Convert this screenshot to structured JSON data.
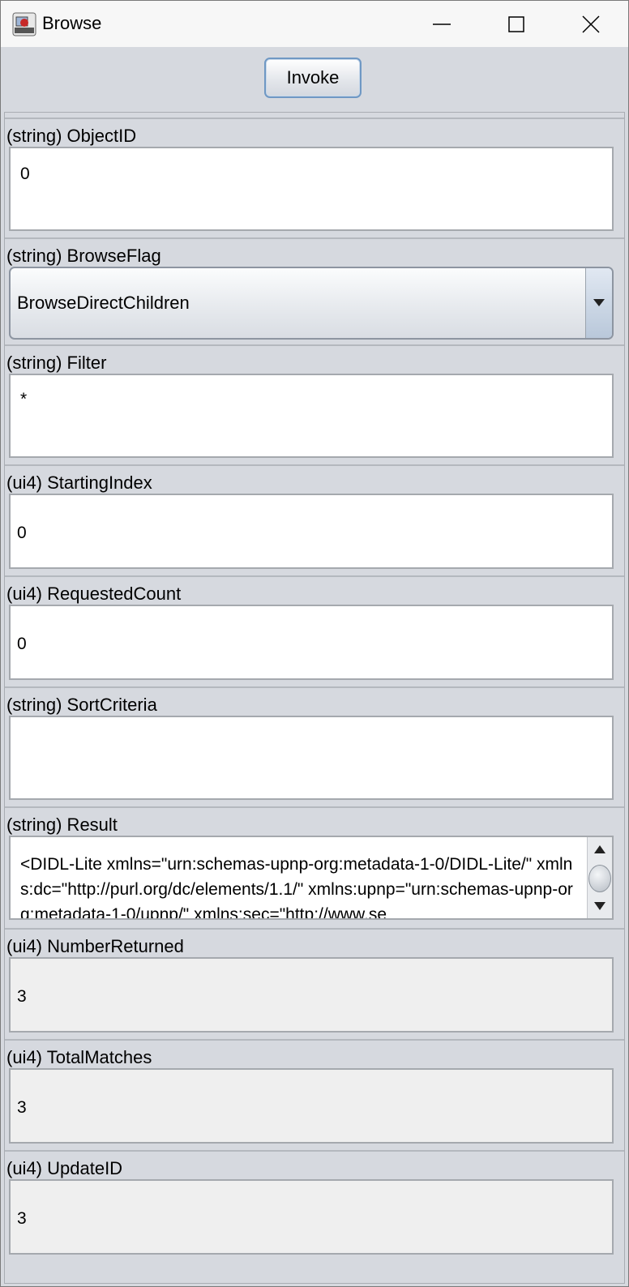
{
  "window": {
    "title": "Browse",
    "icon": "app-icon",
    "controls": [
      "minimize-icon",
      "maximize-icon",
      "close-icon"
    ]
  },
  "toolbar": {
    "invoke_label": "Invoke"
  },
  "fields": [
    {
      "label": "(string) ObjectID",
      "value": "0"
    },
    {
      "label": "(string) BrowseFlag",
      "value": "BrowseDirectChildren"
    },
    {
      "label": "(string) Filter",
      "value": "*"
    },
    {
      "label": "(ui4) StartingIndex",
      "value": "0"
    },
    {
      "label": "(ui4) RequestedCount",
      "value": "0"
    },
    {
      "label": "(string) SortCriteria",
      "value": ""
    },
    {
      "label": "(string) Result",
      "value": "<DIDL-Lite xmlns=\"urn:schemas-upnp-org:metadata-1-0/DIDL-Lite/\" xmlns:dc=\"http://purl.org/dc/elements/1.1/\" xmlns:upnp=\"urn:schemas-upnp-org:metadata-1-0/upnp/\" xmlns:sec=\"http://www.se"
    },
    {
      "label": "(ui4) NumberReturned",
      "value": "3"
    },
    {
      "label": "(ui4) TotalMatches",
      "value": "3"
    },
    {
      "label": "(ui4) UpdateID",
      "value": "3"
    }
  ]
}
